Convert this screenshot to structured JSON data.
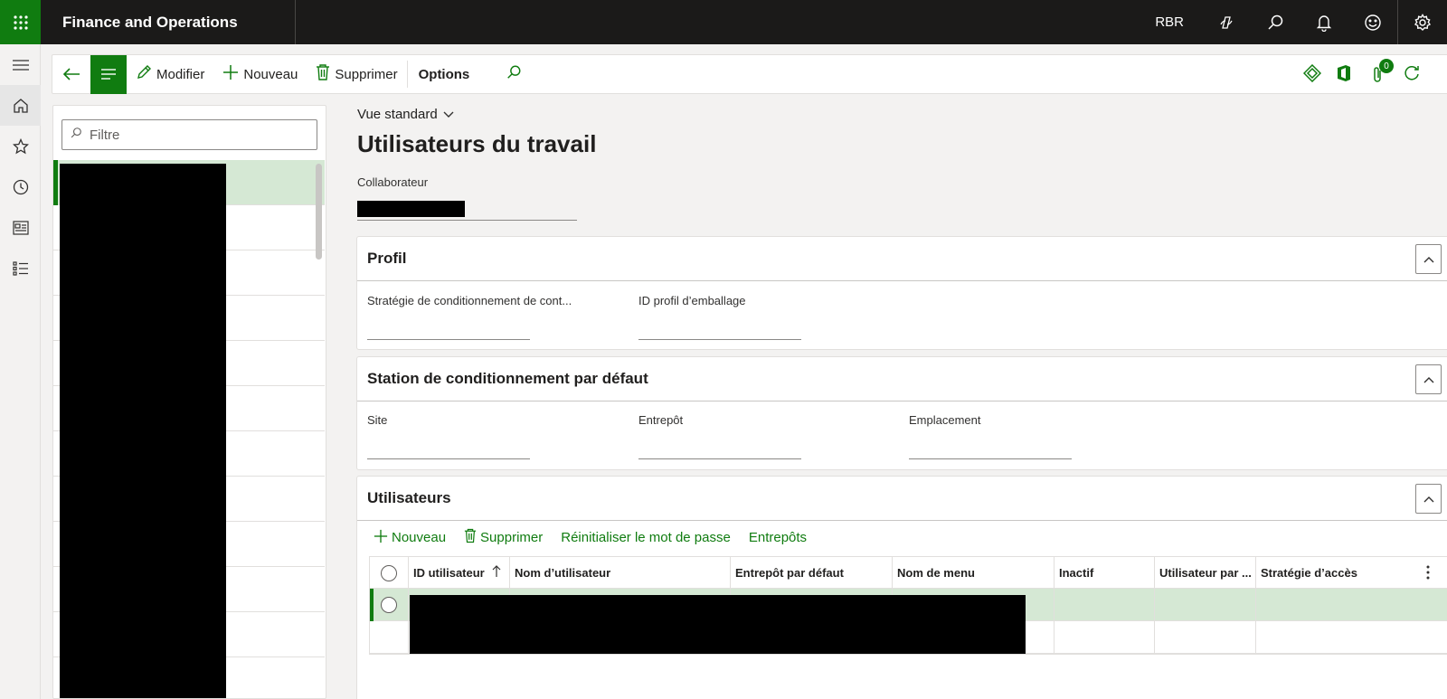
{
  "topbar": {
    "title": "Finance and Operations",
    "company": "RBR",
    "icons": [
      "waffle-icon",
      "copilot-icon",
      "search-icon",
      "bell-icon",
      "smiley-icon",
      "gear-icon"
    ]
  },
  "leftnav": {
    "icons": [
      "hamburger-icon",
      "home-icon",
      "star-icon",
      "clock-icon",
      "workspace-icon",
      "list-icon"
    ]
  },
  "actionpane": {
    "modifier": "Modifier",
    "nouveau": "Nouveau",
    "supprimer": "Supprimer",
    "options": "Options",
    "attachments_count": "0"
  },
  "listpane": {
    "filter_placeholder": "Filtre",
    "row_count": 12
  },
  "main": {
    "view": "Vue standard",
    "title": "Utilisateurs du travail",
    "collab_label": "Collaborateur"
  },
  "profil": {
    "title": "Profil",
    "field1": "Stratégie de conditionnement de cont...",
    "field2": "ID profil d’emballage"
  },
  "station": {
    "title": "Station de conditionnement par défaut",
    "site": "Site",
    "entrepot": "Entrepôt",
    "emplacement": "Emplacement"
  },
  "users": {
    "title": "Utilisateurs",
    "nouveau": "Nouveau",
    "supprimer": "Supprimer",
    "reset_pw": "Réinitialiser le mot de passe",
    "entrepots": "Entrepôts",
    "columns": [
      "ID utilisateur",
      "Nom d’utilisateur",
      "Entrepôt par défaut",
      "Nom de menu",
      "Inactif",
      "Utilisateur par ...",
      "Stratégie d’accès"
    ]
  },
  "colors": {
    "accent": "#107c10",
    "topbar": "#1b1a19",
    "selected": "#d5e8d4"
  }
}
